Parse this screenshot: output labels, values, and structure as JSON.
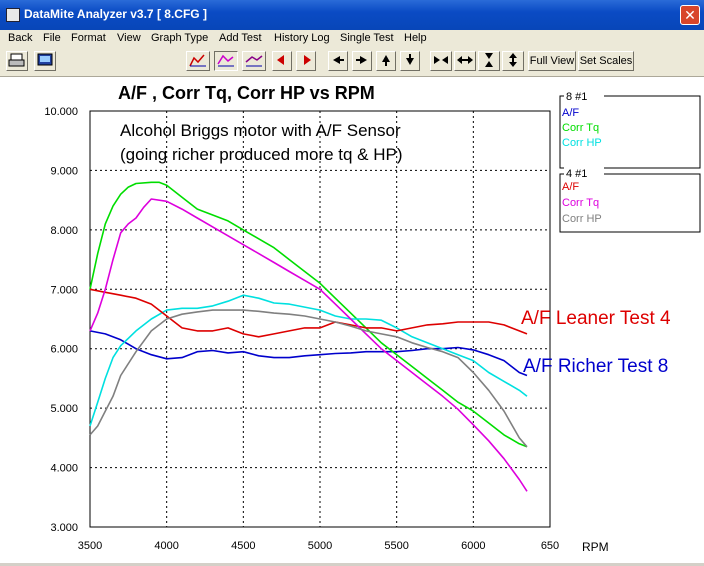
{
  "window": {
    "title": "DataMite Analyzer v3.7  [ 8.CFG ]",
    "close": "✕"
  },
  "menu": [
    "Back",
    "File",
    "Format",
    "View",
    "Graph Type",
    "Add Test",
    "History Log",
    "Single Test",
    "Help"
  ],
  "toolbar": {
    "full_view": "Full View",
    "set_scales": "Set Scales"
  },
  "chart_data": {
    "type": "line",
    "title": "A/F , Corr Tq, Corr HP vs RPM",
    "annotation_lines": [
      "Alcohol Briggs motor with A/F Sensor",
      "(going richer produced more tq & HP)"
    ],
    "label_leaner": "A/F Leaner Test 4",
    "label_richer": "A/F Richer Test 8",
    "xlabel": "RPM",
    "x_ticks": [
      "3500",
      "4000",
      "4500",
      "5000",
      "5500",
      "6000",
      "650"
    ],
    "y_ticks": [
      "3.000",
      "4.000",
      "5.000",
      "6.000",
      "7.000",
      "8.000",
      "9.000",
      "10.000"
    ],
    "xlim": [
      3500,
      6500
    ],
    "ylim": [
      3,
      10
    ],
    "legend_groups": [
      {
        "header": "8   #1",
        "items": [
          {
            "name": "A/F",
            "color": "#0000cc"
          },
          {
            "name": "Corr Tq",
            "color": "#00dd00"
          },
          {
            "name": "Corr HP",
            "color": "#00e0e0"
          }
        ]
      },
      {
        "header": "4   #1",
        "items": [
          {
            "name": "A/F",
            "color": "#dd0000"
          },
          {
            "name": "Corr Tq",
            "color": "#dd00dd"
          },
          {
            "name": "Corr HP",
            "color": "#808080"
          }
        ]
      }
    ],
    "series": [
      {
        "color": "#0000cc",
        "x": [
          3500,
          3600,
          3700,
          3800,
          3900,
          4000,
          4100,
          4200,
          4300,
          4400,
          4500,
          4600,
          4700,
          4800,
          4900,
          5000,
          5100,
          5200,
          5300,
          5400,
          5500,
          5600,
          5700,
          5800,
          5900,
          6000,
          6100,
          6200,
          6300,
          6350
        ],
        "y": [
          6.3,
          6.25,
          6.15,
          6.0,
          5.9,
          5.83,
          5.85,
          5.95,
          5.97,
          5.93,
          5.95,
          5.88,
          5.85,
          5.85,
          5.88,
          5.9,
          5.92,
          5.93,
          5.95,
          5.95,
          5.95,
          5.97,
          6.0,
          6.0,
          6.02,
          5.98,
          5.9,
          5.8,
          5.6,
          5.55
        ]
      },
      {
        "color": "#00dd00",
        "x": [
          3500,
          3550,
          3600,
          3650,
          3700,
          3750,
          3800,
          3900,
          3950,
          4000,
          4100,
          4200,
          4300,
          4400,
          4500,
          4600,
          4700,
          4800,
          4900,
          5000,
          5100,
          5200,
          5300,
          5400,
          5500,
          5600,
          5700,
          5800,
          5900,
          6000,
          6100,
          6200,
          6300,
          6350
        ],
        "y": [
          7.0,
          7.6,
          8.1,
          8.4,
          8.6,
          8.72,
          8.78,
          8.8,
          8.8,
          8.75,
          8.55,
          8.35,
          8.25,
          8.15,
          8.0,
          7.85,
          7.7,
          7.5,
          7.3,
          7.1,
          6.85,
          6.6,
          6.35,
          6.1,
          5.9,
          5.7,
          5.5,
          5.3,
          5.1,
          4.95,
          4.75,
          4.55,
          4.4,
          4.35
        ]
      },
      {
        "color": "#00e0e0",
        "x": [
          3500,
          3550,
          3600,
          3650,
          3700,
          3800,
          3900,
          4000,
          4100,
          4200,
          4300,
          4400,
          4500,
          4600,
          4700,
          4800,
          4900,
          5000,
          5100,
          5200,
          5300,
          5400,
          5500,
          5600,
          5700,
          5800,
          5900,
          6000,
          6100,
          6200,
          6300,
          6350
        ],
        "y": [
          4.7,
          5.1,
          5.5,
          5.85,
          6.05,
          6.3,
          6.5,
          6.65,
          6.68,
          6.68,
          6.72,
          6.8,
          6.9,
          6.85,
          6.77,
          6.75,
          6.7,
          6.65,
          6.55,
          6.5,
          6.5,
          6.48,
          6.35,
          6.2,
          6.1,
          6.0,
          5.9,
          5.8,
          5.6,
          5.45,
          5.3,
          5.2
        ]
      },
      {
        "color": "#dd0000",
        "x": [
          3500,
          3600,
          3700,
          3800,
          3900,
          4000,
          4100,
          4200,
          4300,
          4400,
          4500,
          4600,
          4700,
          4800,
          4900,
          5000,
          5100,
          5200,
          5300,
          5400,
          5500,
          5600,
          5700,
          5800,
          5900,
          6000,
          6100,
          6200,
          6300,
          6350
        ],
        "y": [
          7.0,
          6.95,
          6.9,
          6.85,
          6.75,
          6.55,
          6.35,
          6.3,
          6.3,
          6.35,
          6.25,
          6.2,
          6.25,
          6.3,
          6.35,
          6.35,
          6.45,
          6.4,
          6.35,
          6.35,
          6.3,
          6.35,
          6.4,
          6.42,
          6.45,
          6.45,
          6.45,
          6.4,
          6.3,
          6.25
        ]
      },
      {
        "color": "#dd00dd",
        "x": [
          3500,
          3550,
          3600,
          3650,
          3700,
          3750,
          3800,
          3850,
          3900,
          4000,
          4100,
          4200,
          4300,
          4400,
          4500,
          4600,
          4700,
          4800,
          4900,
          5000,
          5100,
          5200,
          5300,
          5400,
          5500,
          5600,
          5700,
          5800,
          5900,
          6000,
          6100,
          6200,
          6300,
          6350
        ],
        "y": [
          6.3,
          6.6,
          7.0,
          7.5,
          7.95,
          8.1,
          8.2,
          8.38,
          8.52,
          8.48,
          8.35,
          8.2,
          8.05,
          7.9,
          7.75,
          7.6,
          7.45,
          7.3,
          7.15,
          7.0,
          6.75,
          6.5,
          6.25,
          6.0,
          5.8,
          5.6,
          5.4,
          5.2,
          4.98,
          4.72,
          4.45,
          4.15,
          3.8,
          3.6
        ]
      },
      {
        "color": "#808080",
        "x": [
          3500,
          3550,
          3600,
          3650,
          3700,
          3800,
          3900,
          4000,
          4100,
          4200,
          4300,
          4400,
          4500,
          4600,
          4700,
          4800,
          4900,
          5000,
          5100,
          5200,
          5300,
          5400,
          5500,
          5600,
          5700,
          5800,
          5900,
          6000,
          6100,
          6200,
          6300,
          6350
        ],
        "y": [
          4.55,
          4.7,
          4.95,
          5.2,
          5.55,
          5.95,
          6.3,
          6.5,
          6.58,
          6.62,
          6.65,
          6.65,
          6.65,
          6.63,
          6.6,
          6.58,
          6.55,
          6.5,
          6.45,
          6.38,
          6.3,
          6.25,
          6.2,
          6.1,
          6.02,
          5.95,
          5.85,
          5.6,
          5.3,
          4.95,
          4.5,
          4.35
        ]
      }
    ]
  }
}
